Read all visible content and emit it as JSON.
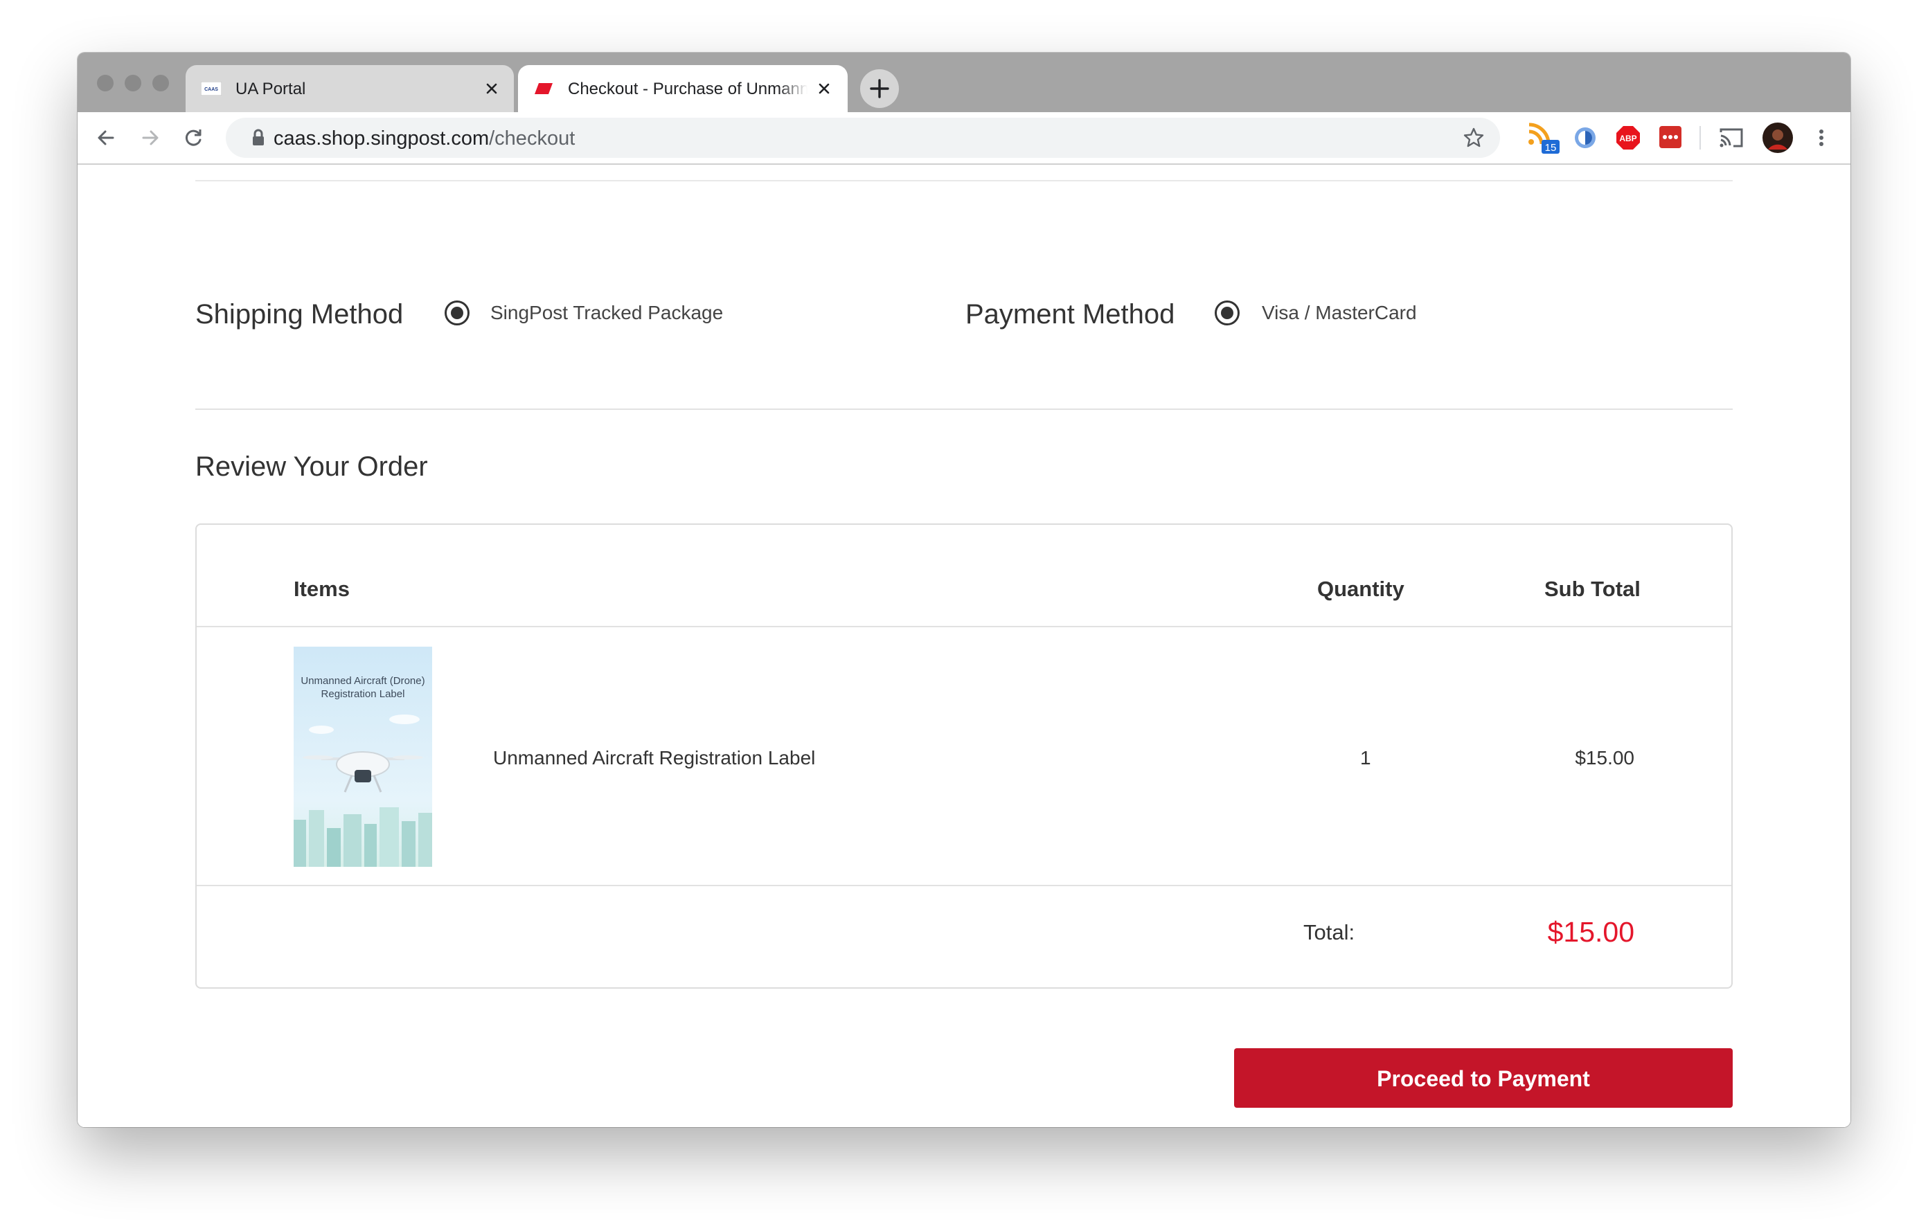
{
  "browser": {
    "tabs": [
      {
        "title": "UA Portal",
        "active": false,
        "favicon_text": "CAAS"
      },
      {
        "title": "Checkout - Purchase of Unmanned Aircraft Registration Label",
        "active": true
      }
    ],
    "address": {
      "host": "caas.shop.singpost.com",
      "path": "/checkout"
    },
    "extension_badge": "15",
    "abp_label": "ABP"
  },
  "shipping": {
    "heading": "Shipping Method",
    "option_label": "SingPost Tracked Package"
  },
  "payment": {
    "heading": "Payment Method",
    "option_label": "Visa / MasterCard"
  },
  "review": {
    "heading": "Review Your Order",
    "columns": {
      "items": "Items",
      "quantity": "Quantity",
      "subtotal": "Sub Total"
    },
    "rows": [
      {
        "thumbnail_text": "Unmanned Aircraft (Drone) Registration Label",
        "name": "Unmanned Aircraft Registration Label",
        "quantity": "1",
        "subtotal": "$15.00"
      }
    ],
    "total_label": "Total:",
    "total_value": "$15.00"
  },
  "actions": {
    "proceed_label": "Proceed to Payment"
  },
  "colors": {
    "accent_red": "#c41529",
    "total_red": "#e4162b"
  }
}
